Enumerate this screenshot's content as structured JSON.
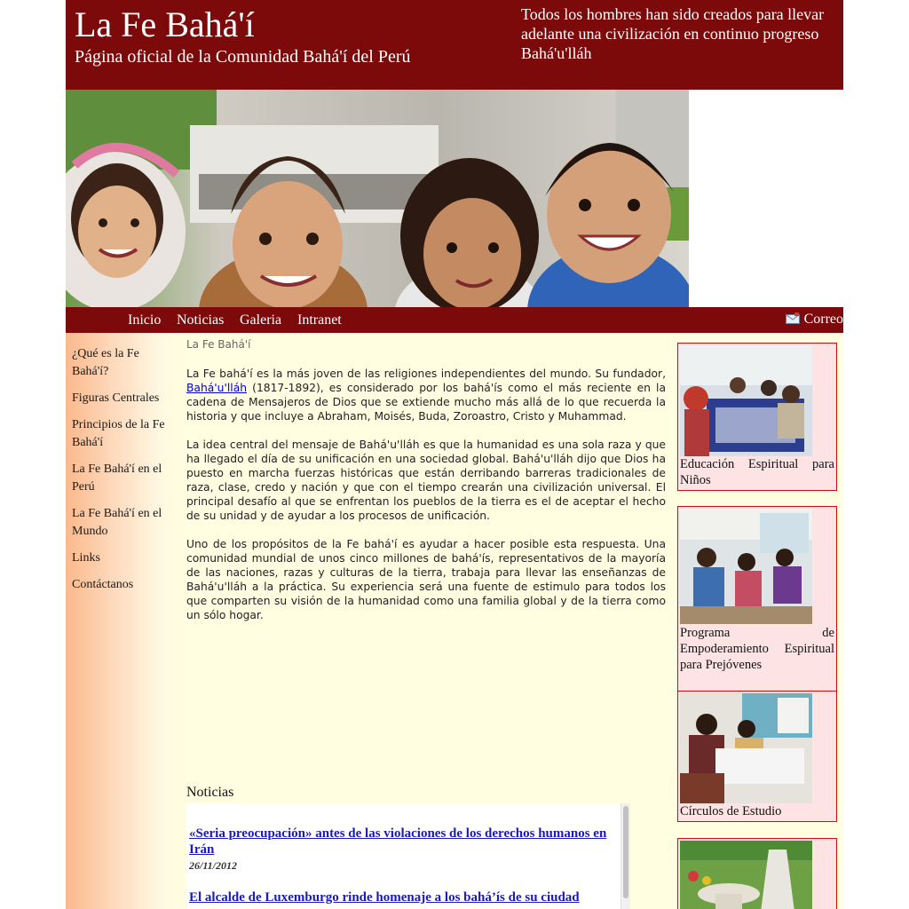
{
  "header": {
    "title": "La Fe Bahá'í",
    "subtitle": "Página oficial de la Comunidad Bahá'í del Perú",
    "quote": "Todos los hombres han sido creados para llevar adelante una civilización en continuo progreso",
    "quote_author": "Bahá'u'lláh"
  },
  "nav": {
    "items": [
      "Inicio",
      "Noticias",
      "Galeria",
      "Intranet"
    ],
    "mail_label": "Correo"
  },
  "sidebar": {
    "items": [
      "¿Qué es la Fe Bahá'í?",
      "Figuras Centrales",
      "Principios de la Fe Bahá'í",
      "La Fe Bahá'í en el Perú",
      "La Fe Bahá'í en el Mundo",
      "Links",
      "Contáctanos"
    ]
  },
  "main": {
    "heading": "La Fe Bahá'í",
    "p1_before": "La Fe bahá'í es la más joven de las religiones independientes del mundo. Su fundador, ",
    "p1_link": "Bahá'u'lláh",
    "p1_after": " (1817-1892), es considerado por los bahá'ís como el más reciente en la cadena de Mensajeros de Dios que se extiende mucho más allá de lo que recuerda la historia y que incluye a Abraham, Moisés, Buda, Zoroastro, Cristo y Muhammad.",
    "p2": "La idea central del mensaje de Bahá'u'lláh es que la humanidad es una sola raza y que ha llegado el día de su unificación en una sociedad global. Bahá'u'lláh dijo que Dios ha puesto en marcha fuerzas históricas que están derribando barreras tradicionales de raza, clase, credo y nación y que con el tiempo crearán una civilización universal. El principal desafío al que se enfrentan los pueblos de la tierra es el de aceptar el hecho de su unidad y de ayudar a los procesos de unificación.",
    "p3": "Uno de los propósitos de la Fe bahá'í es ayudar a hacer posible esta respuesta. Una comunidad mundial de unos cinco millones de bahá'ís, representativos de la mayoría de las naciones, razas y culturas de la tierra, trabaja para llevar las enseñanzas de Bahá'u'lláh a la práctica. Su experiencia será una fuente de estimulo para todos los que comparten su visión de la humanidad como una familia global y de la tierra como un sólo hogar."
  },
  "news": {
    "heading": "Noticias",
    "items": [
      {
        "title": "«Seria preocupación» antes de las violaciones de los derechos humanos en Irán",
        "date": "26/11/2012"
      },
      {
        "title": "El alcalde de Luxemburgo rinde homenaje a los bahá’ís de su ciudad",
        "date": ""
      }
    ]
  },
  "cards": [
    {
      "label": "Educación Espiritual para Niños"
    },
    {
      "label": "Programa de Empoderamiento Espiritual para Prejóvenes"
    },
    {
      "label": "Círculos de Estudio"
    },
    {
      "label": ""
    }
  ],
  "colors": {
    "header_bg": "#7d0a0a",
    "page_bg": "#fffee0",
    "card_bg": "#fde3e3",
    "card_border": "#c81010",
    "link": "#0000cc"
  }
}
